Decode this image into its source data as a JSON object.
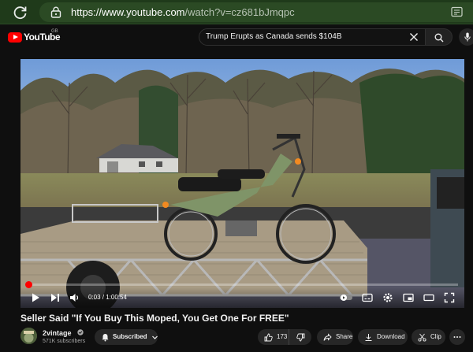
{
  "browser": {
    "url_host": "https://www.youtube.com",
    "url_path": "/watch?v=cz681bJmqpc"
  },
  "header": {
    "logo_text": "YouTube",
    "country_code": "GB",
    "search_value": "Trump Erupts as Canada sends $104B"
  },
  "player": {
    "time_display": "0:03 / 1:00:54",
    "progress_fraction": 0.003
  },
  "video": {
    "title": "Seller Said \"If You Buy This Moped, You Get One For FREE\"",
    "channel_name": "2vintage",
    "subscribers": "571K subscribers",
    "subscribe_label": "Subscribed",
    "like_count": "173",
    "share_label": "Share",
    "download_label": "Download",
    "clip_label": "Clip"
  },
  "colors": {
    "accent": "#ff0000",
    "browser_bar": "#1f3a1a"
  }
}
